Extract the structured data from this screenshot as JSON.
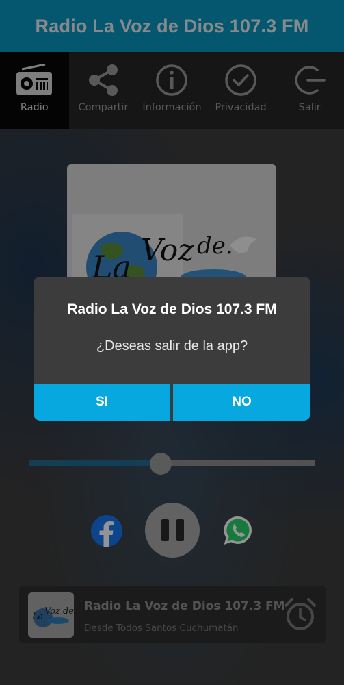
{
  "header": {
    "title": "Radio La Voz de Dios 107.3 FM"
  },
  "menu": {
    "items": [
      {
        "label": "Radio",
        "icon": "radio-icon",
        "active": true
      },
      {
        "label": "Compartir",
        "icon": "share-icon",
        "active": false
      },
      {
        "label": "Información",
        "icon": "info-icon",
        "active": false
      },
      {
        "label": "Privacidad",
        "icon": "check-circle-icon",
        "active": false
      },
      {
        "label": "Salir",
        "icon": "exit-icon",
        "active": false
      }
    ]
  },
  "player": {
    "volume_fraction": 0.46,
    "state": "playing",
    "controls": [
      "facebook-icon",
      "pause-icon",
      "whatsapp-icon"
    ]
  },
  "now_playing": {
    "title": "Radio La Voz de Dios 107.3 FM",
    "subtitle": "Desde Todos Santos Cuchumatán",
    "action_icon": "alarm-clock-icon"
  },
  "dialog": {
    "title": "Radio La Voz de Dios 107.3 FM",
    "message": "¿Deseas salir de la app?",
    "confirm_label": "SI",
    "cancel_label": "NO"
  },
  "colors": {
    "header_bg": "#0a97c0",
    "dialog_button_bg": "#07a8df",
    "slider_fill": "#1f6d93"
  }
}
